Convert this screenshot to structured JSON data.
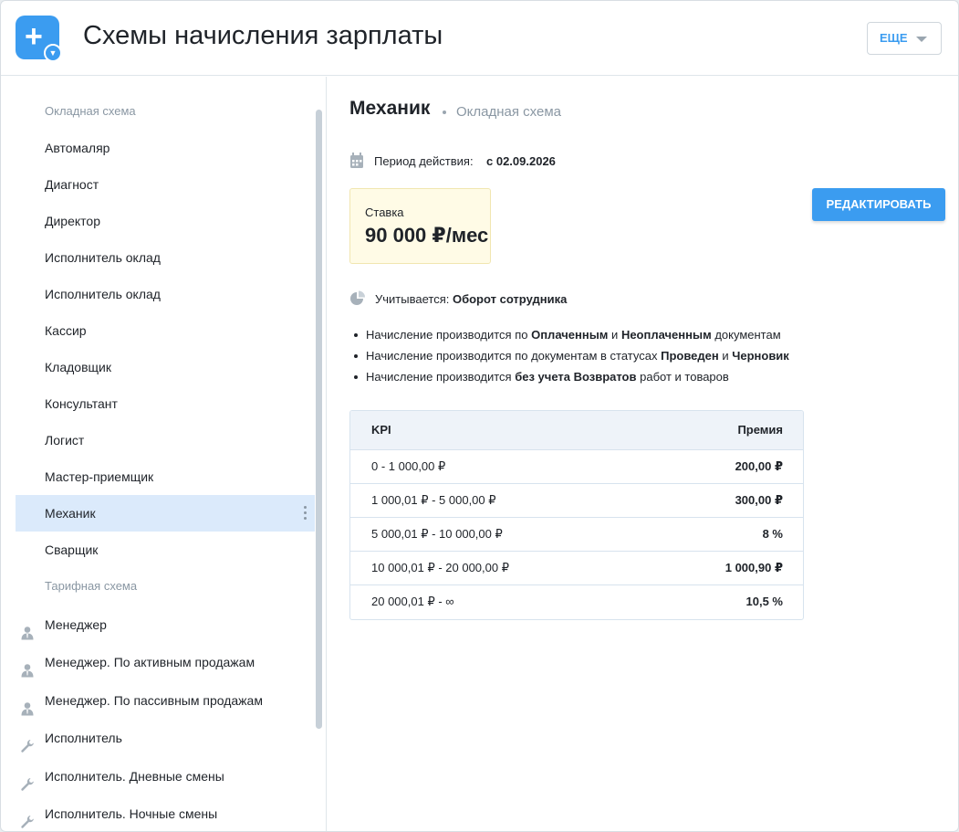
{
  "header": {
    "title": "Схемы начисления зарплаты",
    "more_label": "ЕЩЕ"
  },
  "sidebar": {
    "items": [
      {
        "label": "Окладная схема",
        "type": "group"
      },
      {
        "label": "Автомаляр",
        "type": "item"
      },
      {
        "label": "Диагност",
        "type": "item"
      },
      {
        "label": "Директор",
        "type": "item"
      },
      {
        "label": "Исполнитель оклад",
        "type": "item"
      },
      {
        "label": "Исполнитель оклад",
        "type": "item"
      },
      {
        "label": "Кассир",
        "type": "item"
      },
      {
        "label": "Кладовщик",
        "type": "item"
      },
      {
        "label": "Консультант",
        "type": "item"
      },
      {
        "label": "Логист",
        "type": "item"
      },
      {
        "label": "Мастер-приемщик",
        "type": "item"
      },
      {
        "label": "Механик",
        "type": "item",
        "active": true
      },
      {
        "label": "Сварщик",
        "type": "item"
      },
      {
        "label": "Тарифная схема",
        "type": "group"
      },
      {
        "label": "Менеджер",
        "type": "item",
        "icon": "person-icon"
      },
      {
        "label": "Менеджер. По активным продажам",
        "type": "item",
        "icon": "person-icon"
      },
      {
        "label": "Менеджер. По пассивным продажам",
        "type": "item",
        "icon": "person-icon"
      },
      {
        "label": "Исполнитель",
        "type": "item",
        "icon": "wrench-icon"
      },
      {
        "label": "Исполнитель. Дневные смены",
        "type": "item",
        "icon": "wrench-icon"
      },
      {
        "label": "Исполнитель. Ночные смены",
        "type": "item",
        "icon": "wrench-icon"
      }
    ]
  },
  "detail": {
    "name": "Механик",
    "scheme": "Окладная схема",
    "period_label": "Период действия:",
    "period_value": "с 02.09.2026",
    "rate_label": "Ставка",
    "rate_value": "90 000 ₽/мес",
    "edit_label": "РЕДАКТИРОВАТЬ",
    "considered_label": "Учитывается:",
    "considered_value": "Оборот сотрудника",
    "rules": [
      [
        "Начисление производится по ",
        "Оплаченным",
        " и ",
        "Неоплаченным",
        " документам"
      ],
      [
        "Начисление производится по документам в статусах ",
        "Проведен",
        " и ",
        "Черновик",
        ""
      ],
      [
        "Начисление производится ",
        "без учета Возвратов",
        " работ и товаров",
        "",
        ""
      ]
    ],
    "kpi": {
      "headers": [
        "KPI",
        "Премия"
      ],
      "rows": [
        [
          "0 - 1 000,00 ₽",
          "200,00 ₽"
        ],
        [
          "1 000,01 ₽ - 5 000,00 ₽",
          "300,00 ₽"
        ],
        [
          "5 000,01 ₽ - 10 000,00 ₽",
          "8 %"
        ],
        [
          "10 000,01 ₽ - 20 000,00 ₽",
          "1 000,90 ₽"
        ],
        [
          "20 000,01 ₽ - ∞",
          "10,5 %"
        ]
      ]
    }
  },
  "colors": {
    "accent": "#3b9cf0",
    "active_bg": "#dbeafb",
    "rate_bg": "#fffbe6"
  }
}
